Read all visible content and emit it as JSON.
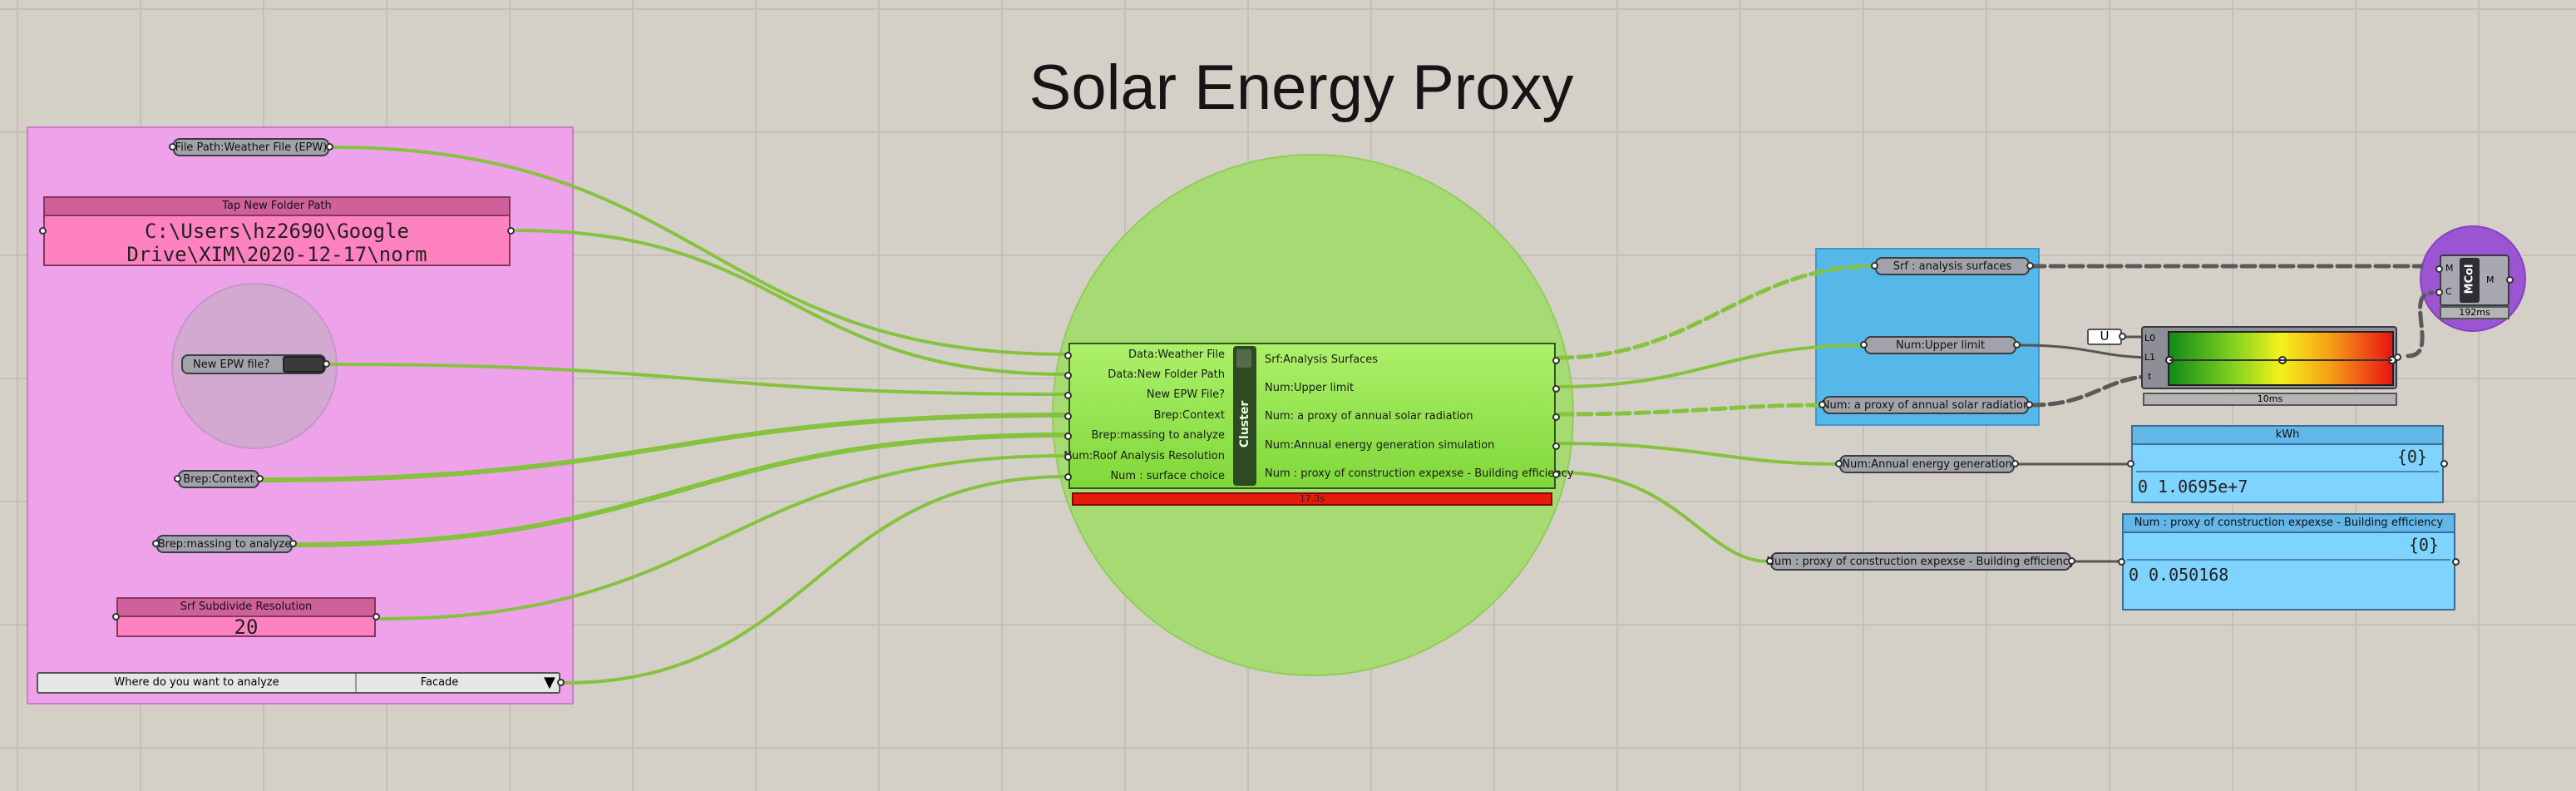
{
  "title": "Solar Energy Proxy",
  "inputs": {
    "file_path_param": "File Path:Weather File (EPW)",
    "folder_panel": {
      "header": "Tap New Folder Path",
      "line1": "C:\\Users\\hz2690\\Google",
      "line2": "Drive\\XIM\\2020-12-17\\norm"
    },
    "epw_toggle": "New EPW file?",
    "context_param": "Brep:Context",
    "massing_param": "Brep:massing to analyze",
    "resolution_slider": {
      "label": "Srf Subdivide Resolution",
      "value": "20"
    },
    "value_list": {
      "label": "Where do you want to analyze",
      "selected": "Facade"
    }
  },
  "cluster": {
    "label": "Cluster",
    "inputs": [
      "Data:Weather File",
      "Data:New Folder Path",
      "New EPW File?",
      "Brep:Context",
      "Brep:massing to analyze",
      "Num:Roof Analysis Resolution",
      "Num : surface choice"
    ],
    "outputs": [
      "Srf:Analysis Surfaces",
      "Num:Upper limit",
      "Num: a proxy of annual solar radiation",
      "Num:Annual energy generation simulation",
      "Num : proxy of construction expexse - Building efficiency"
    ],
    "runtime": "17.3s"
  },
  "outputs": {
    "srf_param": "Srf : analysis surfaces",
    "upper_param": "Num:Upper limit",
    "solar_param": "Num: a proxy of annual solar radiation",
    "energy_param": "Num:Annual energy generation",
    "cost_param": "Num : proxy of construction expexse - Building efficiency",
    "union_label": "U",
    "gradient": {
      "inputs": [
        "L0",
        "L1",
        "t"
      ],
      "runtime": "10ms"
    },
    "mcol": {
      "label": "MCol",
      "inputs": [
        "M",
        "C"
      ],
      "output": "M",
      "runtime": "192ms"
    },
    "kwh_panel": {
      "header": "kWh",
      "path": "{0}",
      "index": "0",
      "value": "1.0695e+7"
    },
    "cost_panel": {
      "header": "Num : proxy of construction expexse - Building efficiency",
      "path": "{0}",
      "index": "0",
      "value": "0.050168"
    }
  },
  "colors": {
    "wire": "#86c23e",
    "pink_group": "#eda2ea",
    "blue_group": "#55b8e8",
    "cluster": "#8fe04a",
    "runtime_bar": "#e81a0c",
    "purple_group": "#9b54d2"
  }
}
